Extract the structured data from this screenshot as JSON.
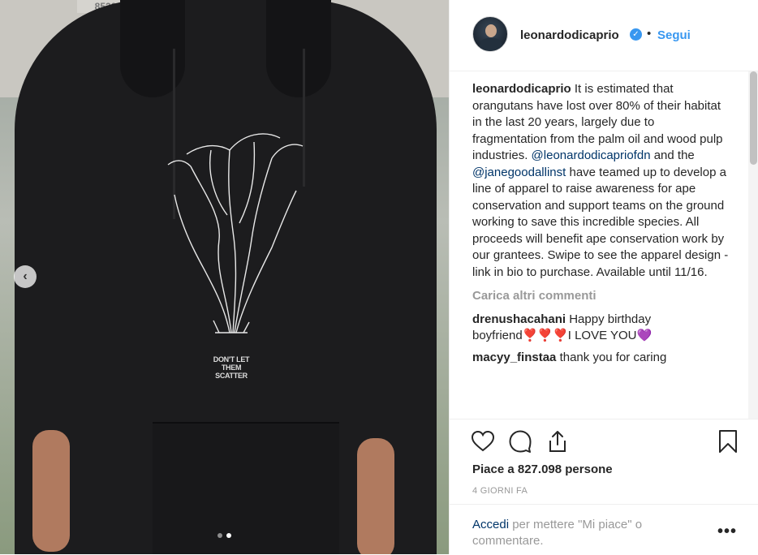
{
  "media": {
    "plate_text": "8520",
    "print_text": "DON'T LET THEM SCATTER",
    "carousel": {
      "active_index": 1,
      "count": 2
    }
  },
  "header": {
    "username": "leonardodicaprio",
    "verified_icon": "check",
    "separator": "•",
    "follow_label": "Segui"
  },
  "caption": {
    "username": "leonardodicaprio",
    "text_1": "It is estimated that orangutans have lost over 80% of their habitat in the last 20 years, largely due to fragmentation from the palm oil and wood pulp industries.",
    "mention_1": "@leonardodicapriofdn",
    "text_2": "and the",
    "mention_2": "@janegoodallinst",
    "text_3": "have teamed up to develop a line of apparel to raise awareness for ape conservation and support teams on the ground working to save this incredible species. All proceeds will benefit ape conservation work by our grantees. Swipe to see the apparel design - link in bio to purchase. Available until 11/16."
  },
  "load_more": "Carica altri commenti",
  "comments": [
    {
      "username": "drenushacahani",
      "text": "Happy birthday boyfriend❣️❣️❣️I LOVE YOU💜"
    },
    {
      "username": "macyy_finstaa",
      "text": "thank you for caring"
    }
  ],
  "actions": {
    "icons": [
      "heart-icon",
      "comment-icon",
      "share-icon",
      "bookmark-icon"
    ],
    "likes": "Piace a 827.098 persone",
    "time": "4 GIORNI FA"
  },
  "login": {
    "link": "Accedi",
    "text": "per mettere \"Mi piace\" o commentare.",
    "more": "•••"
  }
}
